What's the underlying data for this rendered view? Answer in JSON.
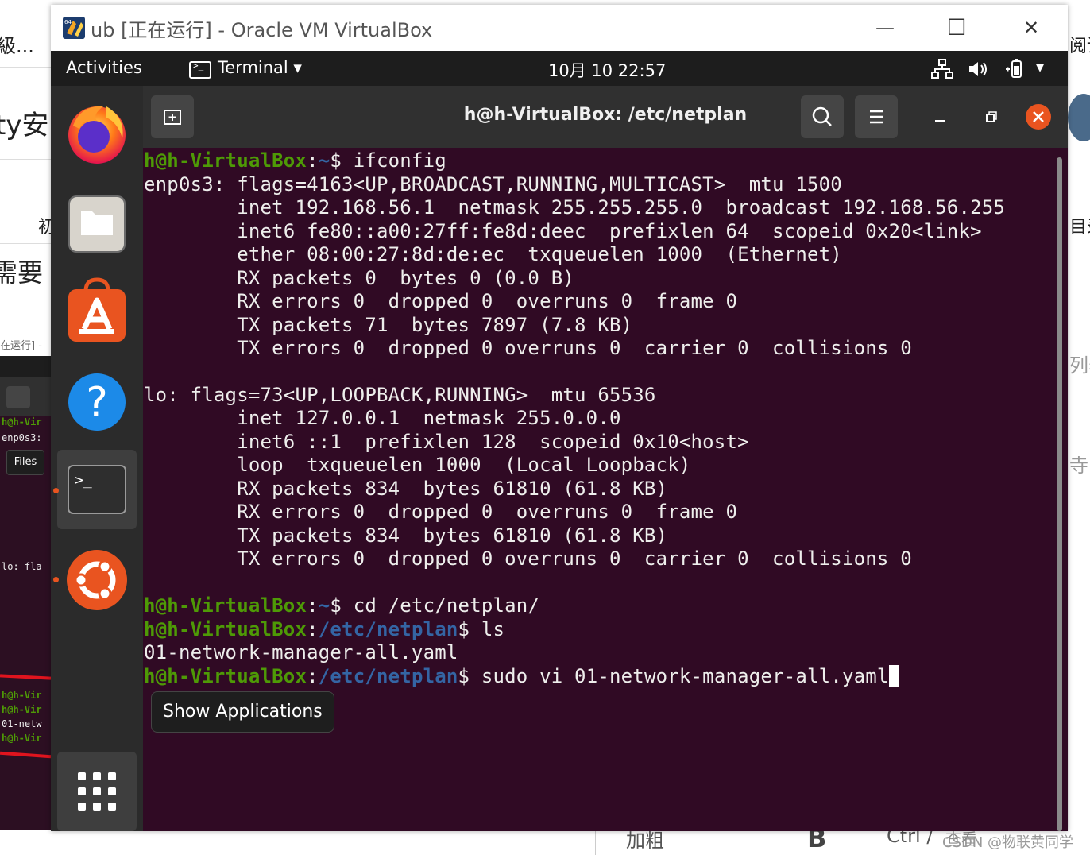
{
  "host": {
    "left_texts": [
      "級...",
      "ty安",
      "初",
      "需要",
      "在运行] -"
    ],
    "right_texts": [
      "阅读",
      "目录",
      "列表",
      "寺图"
    ],
    "bottom_texts": [
      "加粗",
      "B",
      "Ctrl /",
      "查看"
    ],
    "mini_term": {
      "files_label": "Files",
      "lines_top": [
        "h@h-Vir",
        "enp0s3:"
      ],
      "lo_line": "lo: fla",
      "lines_bottom": [
        "h@h-Vir",
        "h@h-Vir",
        "01-netw",
        "h@h-Vir"
      ]
    },
    "watermark": "CSDN @物联黄同学"
  },
  "vbox": {
    "title": "ub [正在运行] - Oracle VM VirtualBox",
    "minimize": "—",
    "maximize": "☐",
    "close": "✕"
  },
  "topbar": {
    "activities": "Activities",
    "app_menu": "Terminal ▾",
    "clock": "10月 10  22:57",
    "tray_menu": "▾"
  },
  "dock": {
    "apps": [
      "firefox",
      "files",
      "ubuntu-software",
      "help",
      "terminal",
      "ubuntu-settings"
    ],
    "show_apps_tooltip": "Show Applications"
  },
  "terminal": {
    "title": "h@h-VirtualBox: /etc/netplan",
    "prompt_user": "h@h-VirtualBox",
    "prompts": [
      {
        "path": "~",
        "cmd": " ifconfig"
      },
      {
        "path": "~",
        "cmd": " cd /etc/netplan/"
      },
      {
        "path": "/etc/netplan",
        "cmd": " ls"
      },
      {
        "path": "/etc/netplan",
        "cmd": " sudo vi 01-network-manager-all.yaml"
      }
    ],
    "enp_lines": [
      "enp0s3: flags=4163<UP,BROADCAST,RUNNING,MULTICAST>  mtu 1500",
      "        inet 192.168.56.1  netmask 255.255.255.0  broadcast 192.168.56.255",
      "        inet6 fe80::a00:27ff:fe8d:deec  prefixlen 64  scopeid 0x20<link>",
      "        ether 08:00:27:8d:de:ec  txqueuelen 1000  (Ethernet)",
      "        RX packets 0  bytes 0 (0.0 B)",
      "        RX errors 0  dropped 0  overruns 0  frame 0",
      "        TX packets 71  bytes 7897 (7.8 KB)",
      "        TX errors 0  dropped 0 overruns 0  carrier 0  collisions 0"
    ],
    "lo_lines": [
      "lo: flags=73<UP,LOOPBACK,RUNNING>  mtu 65536",
      "        inet 127.0.0.1  netmask 255.0.0.0",
      "        inet6 ::1  prefixlen 128  scopeid 0x10<host>",
      "        loop  txqueuelen 1000  (Local Loopback)",
      "        RX packets 834  bytes 61810 (61.8 KB)",
      "        RX errors 0  dropped 0  overruns 0  frame 0",
      "        TX packets 834  bytes 61810 (61.8 KB)",
      "        TX errors 0  dropped 0 overruns 0  carrier 0  collisions 0"
    ],
    "ls_output": "01-network-manager-all.yaml"
  },
  "colors": {
    "terminal_bg": "#300a24",
    "prompt_user": "#4e9a06",
    "prompt_path": "#3465a4",
    "ubuntu_orange": "#e95420"
  }
}
